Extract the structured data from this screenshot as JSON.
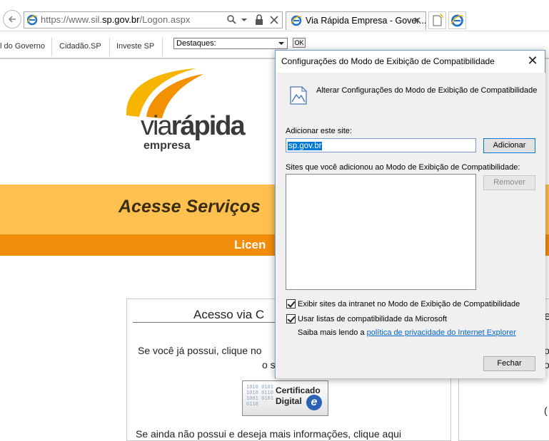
{
  "browser": {
    "url_prefix": "https://www.sil.",
    "url_domain": "sp.gov.br",
    "url_path": "/Logon.aspx",
    "tab_title": "Via Rápida Empresa - Gover...",
    "tab_close": "✕"
  },
  "sitenav": {
    "links": [
      "l do Governo",
      "Cidadão.SP",
      "Investe SP"
    ],
    "destaques_value": "Destaques:",
    "ok_label": "OK"
  },
  "page": {
    "logo_via": "via",
    "logo_rapida": "rápida",
    "logo_sub": "empresa",
    "banner_title": "Acesse Serviços",
    "banner_sub": "Licen",
    "card_title": "Acesso via C",
    "card_text1": "Se você já possui, clique no",
    "card_text2": "o s",
    "cert_line1": "Certificado",
    "cert_line2": "Digital",
    "cert_e": "e",
    "cert_digits": "1010 0101 1010 0110 1001 0101 0110",
    "card_bottom": "Se ainda não possui e deseja mais informações, clique aqui",
    "card2_a": "e",
    "card2_b": "p",
    "card2_c": "o",
    "card2_d": "("
  },
  "dialog": {
    "title": "Configurações do Modo de Exibição de Compatibilidade",
    "close_glyph": "✕",
    "heading": "Alterar Configurações do Modo de Exibição de Compatibilidade",
    "add_label": "Adicionar este site:",
    "site_value": "sp.gov.br",
    "add_button": "Adicionar",
    "list_label": "Sites que você adicionou ao Modo de Exibição de Compatibilidade:",
    "remove_button": "Remover",
    "chk_intranet": "Exibir sites da intranet no Modo de Exibição de Compatibilidade",
    "chk_microsoft": "Usar listas de compatibilidade da Microsoft",
    "learn_prefix": "Saiba mais lendo a ",
    "learn_link": "política de privacidade do Internet Explorer",
    "close_button": "Fechar"
  },
  "colors": {
    "banner_yellow": "#fec14f",
    "banner_orange": "#f28c0b",
    "dialog_border": "#6e9bd1",
    "link_blue": "#0066cc"
  },
  "icons": [
    "back-arrow-icon",
    "ie-logo-icon",
    "search-icon",
    "dropdown-icon",
    "lock-icon",
    "refresh-icon",
    "new-tab-icon",
    "compatibility-icon"
  ]
}
